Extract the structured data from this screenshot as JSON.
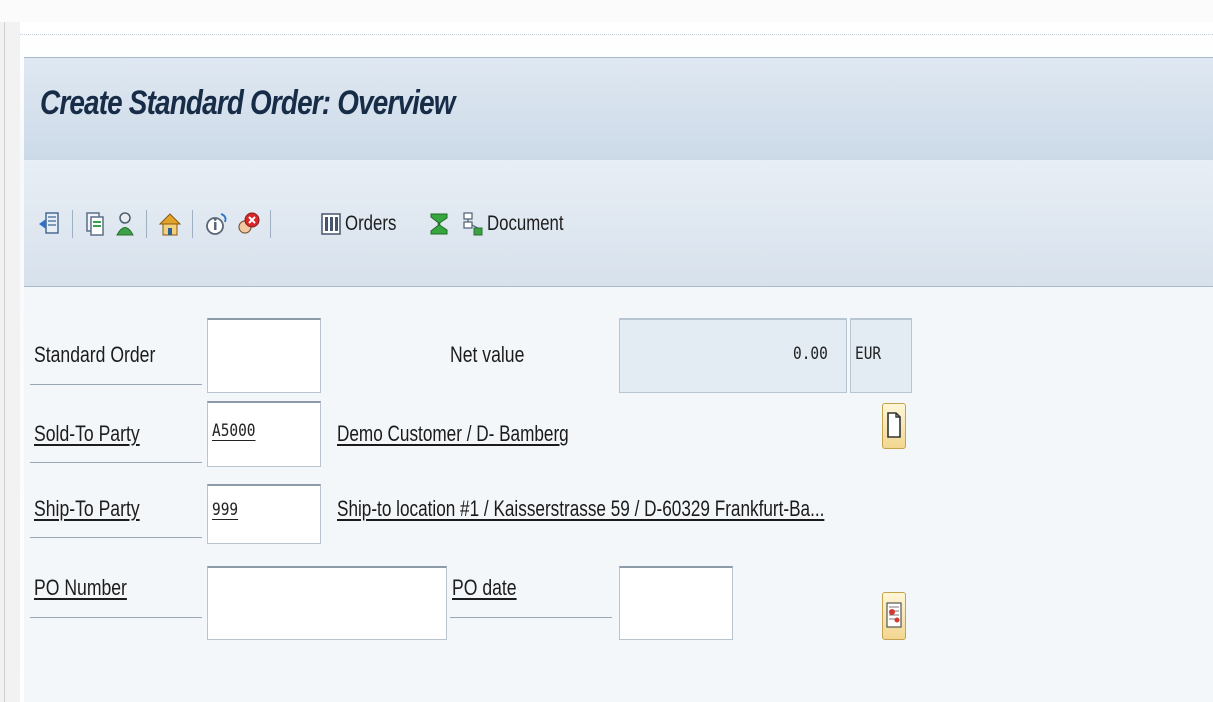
{
  "window": {
    "title": "Create Standard Order: Overview"
  },
  "toolbar": {
    "orders_label": "Orders",
    "document_label": "Document"
  },
  "form": {
    "standard_order": {
      "label": "Standard Order",
      "value": ""
    },
    "net_value": {
      "label": "Net value",
      "value": "0.00",
      "currency": "EUR"
    },
    "sold_to_party": {
      "label": "Sold-To Party",
      "value": "A5000",
      "description": "Demo Customer / D- Bamberg"
    },
    "ship_to_party": {
      "label": "Ship-To Party",
      "value": "999",
      "description": "Ship-to location #1 / Kaisserstrasse 59 / D-60329 Frankfurt-Ba..."
    },
    "po_number": {
      "label": "PO Number",
      "value": ""
    },
    "po_date": {
      "label": "PO date",
      "value": ""
    }
  },
  "colors": {
    "title_bar": "#cfdbe8",
    "toolbar": "#dce5ef",
    "field_border": "#8d9aa8",
    "readonly_field": "#e3ebf3"
  },
  "icons": [
    "display-header-icon",
    "copy-document-icon",
    "user-partner-icon",
    "home-icon",
    "info-icon",
    "cancel-icon",
    "orders-list-icon",
    "sum-icon",
    "document-flow-icon",
    "details-document-icon",
    "po-date-calendar-icon"
  ]
}
